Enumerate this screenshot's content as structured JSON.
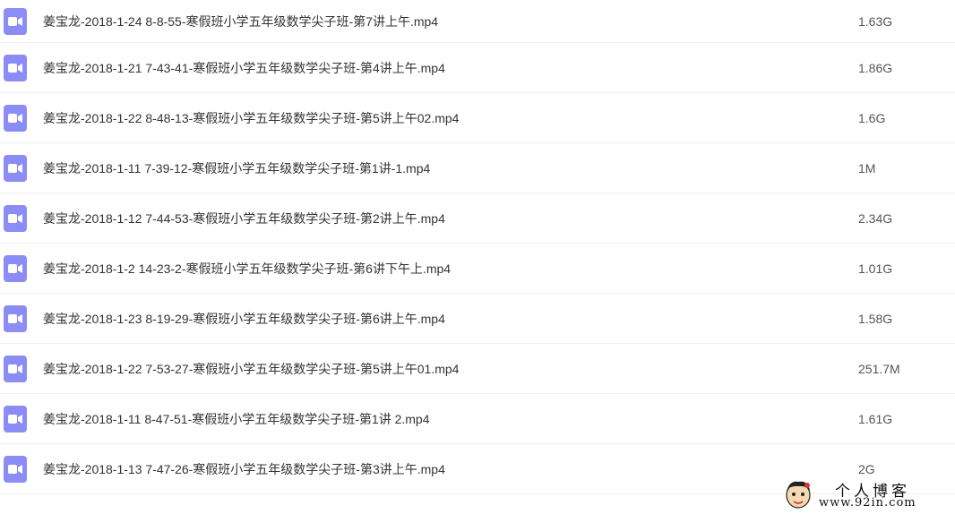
{
  "files": [
    {
      "name": "姜宝龙-2018-1-24 8-8-55-寒假班小学五年级数学尖子班-第7讲上午.mp4",
      "size": "1.63G",
      "icon": "video-file-icon"
    },
    {
      "name": "姜宝龙-2018-1-21 7-43-41-寒假班小学五年级数学尖子班-第4讲上午.mp4",
      "size": "1.86G",
      "icon": "video-file-icon"
    },
    {
      "name": "姜宝龙-2018-1-22 8-48-13-寒假班小学五年级数学尖子班-第5讲上午02.mp4",
      "size": "1.6G",
      "icon": "video-file-icon"
    },
    {
      "name": "姜宝龙-2018-1-11 7-39-12-寒假班小学五年级数学尖子班-第1讲-1.mp4",
      "size": "1M",
      "icon": "video-file-icon"
    },
    {
      "name": "姜宝龙-2018-1-12 7-44-53-寒假班小学五年级数学尖子班-第2讲上午.mp4",
      "size": "2.34G",
      "icon": "video-file-icon"
    },
    {
      "name": "姜宝龙-2018-1-2 14-23-2-寒假班小学五年级数学尖子班-第6讲下午上.mp4",
      "size": "1.01G",
      "icon": "video-file-icon"
    },
    {
      "name": "姜宝龙-2018-1-23 8-19-29-寒假班小学五年级数学尖子班-第6讲上午.mp4",
      "size": "1.58G",
      "icon": "video-file-icon"
    },
    {
      "name": "姜宝龙-2018-1-22 7-53-27-寒假班小学五年级数学尖子班-第5讲上午01.mp4",
      "size": "251.7M",
      "icon": "video-file-icon"
    },
    {
      "name": "姜宝龙-2018-1-11 8-47-51-寒假班小学五年级数学尖子班-第1讲 2.mp4",
      "size": "1.61G",
      "icon": "video-file-icon"
    },
    {
      "name": "姜宝龙-2018-1-13 7-47-26-寒假班小学五年级数学尖子班-第3讲上午.mp4",
      "size": "2G",
      "icon": "video-file-icon"
    }
  ],
  "watermark": {
    "title": "个人博客",
    "url": "www.92in.com"
  },
  "colors": {
    "icon_bg": "#8b8cf6",
    "text": "#333333",
    "divider": "#f0f0f2"
  }
}
